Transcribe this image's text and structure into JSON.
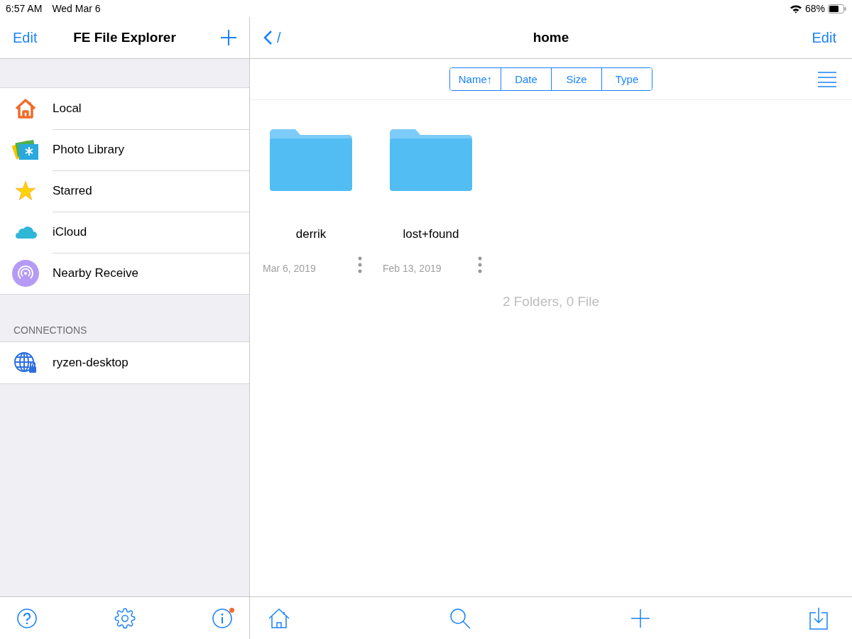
{
  "status_bar": {
    "time": "6:57 AM",
    "date": "Wed Mar 6",
    "battery": "68%"
  },
  "sidebar": {
    "edit": "Edit",
    "title": "FE File Explorer",
    "items": [
      {
        "label": "Local"
      },
      {
        "label": "Photo Library"
      },
      {
        "label": "Starred"
      },
      {
        "label": "iCloud"
      },
      {
        "label": "Nearby Receive"
      }
    ],
    "connections_header": "CONNECTIONS",
    "connections": [
      {
        "label": "ryzen-desktop"
      }
    ],
    "info_badge": true
  },
  "main": {
    "back_path": "/",
    "title": "home",
    "edit": "Edit",
    "sort_options": [
      {
        "label": "Name↑"
      },
      {
        "label": "Date"
      },
      {
        "label": "Size"
      },
      {
        "label": "Type"
      }
    ],
    "folders": [
      {
        "name": "derrik",
        "date": "Mar 6, 2019"
      },
      {
        "name": "lost+found",
        "date": "Feb 13, 2019"
      }
    ],
    "summary": "2 Folders, 0 File"
  }
}
